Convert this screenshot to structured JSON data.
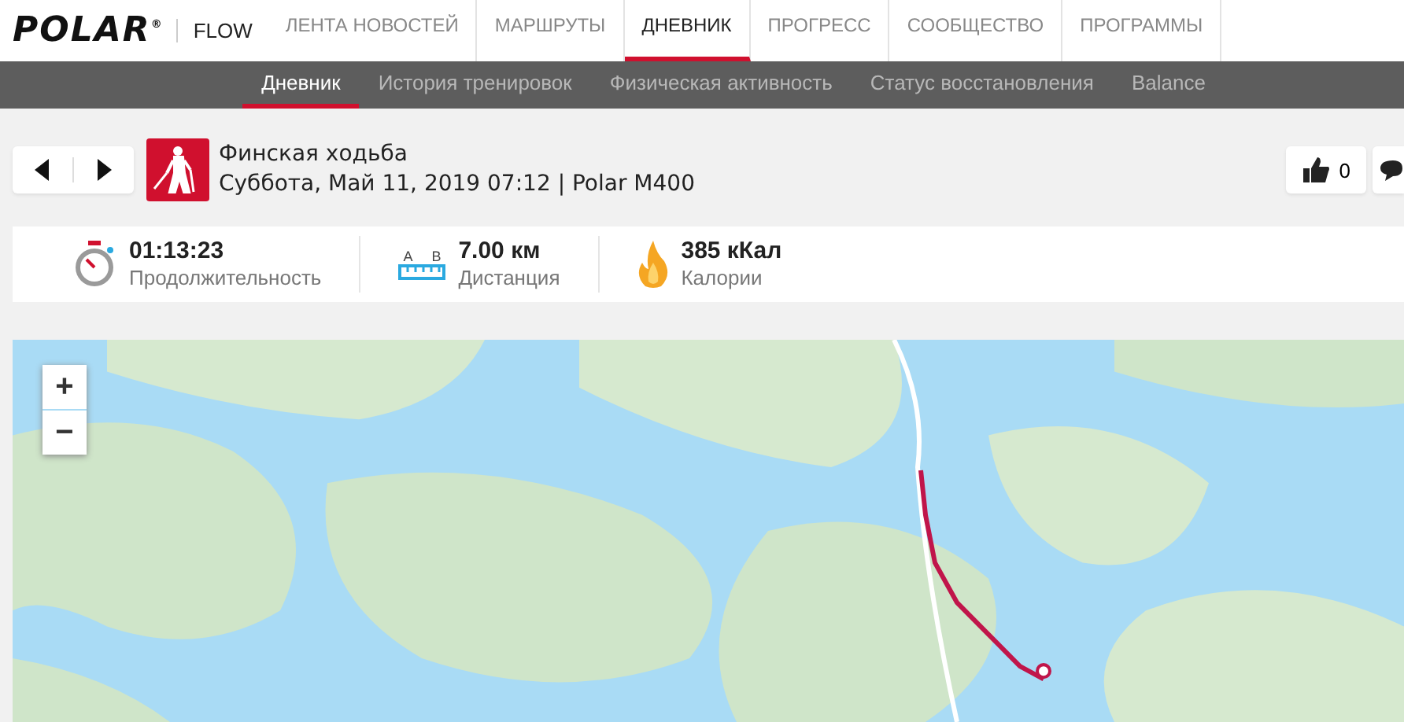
{
  "header": {
    "logo": "POLAR",
    "logo_mark": "®",
    "product": "FLOW",
    "nav": [
      {
        "label": "ЛЕНТА НОВОСТЕЙ",
        "selected": false
      },
      {
        "label": "МАРШРУТЫ",
        "selected": false
      },
      {
        "label": "ДНЕВНИК",
        "selected": true
      },
      {
        "label": "ПРОГРЕСС",
        "selected": false
      },
      {
        "label": "СООБЩЕСТВО",
        "selected": false
      },
      {
        "label": "ПРОГРАММЫ",
        "selected": false
      }
    ]
  },
  "subnav": [
    {
      "label": "Дневник",
      "selected": true
    },
    {
      "label": "История тренировок",
      "selected": false
    },
    {
      "label": "Физическая активность",
      "selected": false
    },
    {
      "label": "Статус восстановления",
      "selected": false
    },
    {
      "label": "Balance",
      "selected": false
    }
  ],
  "session": {
    "title": "Финская ходьба",
    "subtitle": "Суббота, Май 11, 2019 07:12 | Polar M400",
    "likes": "0"
  },
  "stats": [
    {
      "kind": "duration",
      "value": "01:13:23",
      "label": "Продолжительность"
    },
    {
      "kind": "distance",
      "value": "7.00 км",
      "label": "Дистанция",
      "marks": [
        "A",
        "B"
      ]
    },
    {
      "kind": "calories",
      "value": "385 кКал",
      "label": "Калории"
    }
  ],
  "map": {
    "zoom_in": "+",
    "zoom_out": "−"
  }
}
